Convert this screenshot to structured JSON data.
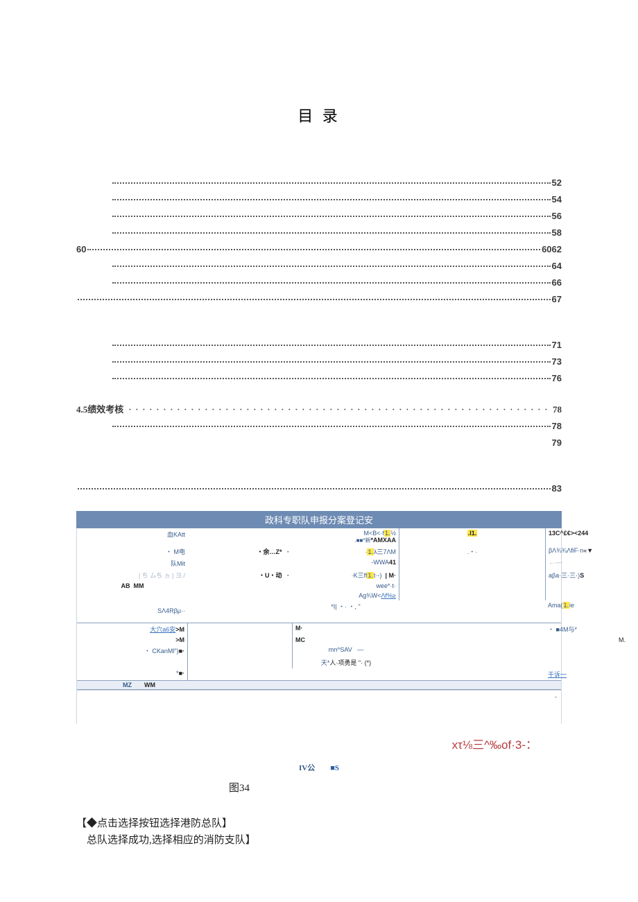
{
  "title": "目 录",
  "toc": {
    "group1": [
      {
        "label": "",
        "page": "52",
        "indent": true
      },
      {
        "label": "",
        "page": "54",
        "indent": true
      },
      {
        "label": "",
        "page": "56",
        "indent": true
      },
      {
        "label": "",
        "page": "58",
        "indent": true
      },
      {
        "label": "60",
        "page": "6062",
        "indent": false
      },
      {
        "label": "",
        "page": "64",
        "indent": true
      },
      {
        "label": "",
        "page": "66",
        "indent": true
      },
      {
        "label": "",
        "page": "67",
        "indent": false
      }
    ],
    "group2": [
      {
        "label": "",
        "page": "71",
        "indent": true
      },
      {
        "label": "",
        "page": "73",
        "indent": true
      },
      {
        "label": "",
        "page": "76",
        "indent": true
      }
    ],
    "heading": {
      "label": "4.5绩效考核",
      "page": "78"
    },
    "group3": [
      {
        "label": "",
        "page": "78",
        "indent": true
      }
    ],
    "right_only": "79",
    "group4": [
      {
        "label": "",
        "page": "83",
        "indent": false
      }
    ]
  },
  "figure": {
    "titlebar": "政科专职队申报分案登记安",
    "row1": {
      "c1": "血KAtt",
      "c3a": "M<B<·f",
      "c3a_hl": "1.",
      "c3a2": "½",
      "c3b_pre": ".■■*新",
      "c3b": "*AMXAA",
      "c4": ".I1.",
      "c5": "13C^£€><244"
    },
    "row2": {
      "c1": "・ M电",
      "c1b": "・余…Z*",
      "c2": "·",
      "c3_pre": "·",
      "c3_hl": "1.",
      "c3": "λ三7ΛM",
      "c4": ".・·",
      "c5": "βΛ¾¾ΛfiF·n",
      "c5b": "«▼"
    },
    "row3": {
      "c1": "队Mit",
      "c3": "-WWA",
      "c3b": "41",
      "c5": "←—·"
    },
    "row4": {
      "c1a": "| ち ムち ヵ | ヨ./",
      "c1b": "・U・动",
      "c2": "·",
      "c3a": "·K三ff",
      "c3a_hl": "1.",
      "c3a2": "t·-)",
      "c3b": "| M·",
      "c5": "aβa·三·三·)",
      "c5b": "S"
    },
    "row5": {
      "c1a": "AB",
      "c1b": "MM",
      "c3": "wee*·",
      "c3b": "t·"
    },
    "row6": {
      "c3": "Ag¾W<",
      "c3b": "Λf%≥"
    },
    "row7": {
      "c1": "SΛ4Rβμ··",
      "c3": "*I| ・· ・,  \"",
      "c5a": "Ama(",
      "c5_hl": "1.",
      "c5b": "ie"
    },
    "sec2": {
      "r1": {
        "c1": "大穴a6安",
        "c1b": ">M",
        "c3": "M·",
        "c5a": "・ ■4M与*"
      },
      "r2": {
        "c1b": ">M",
        "c3": "MC",
        "c5b": "M."
      },
      "r3": {
        "c1a": "・ CKanMl\")",
        "c1b": "■·",
        "c3": "mn^SAV",
        "c3b": "—"
      },
      "r4": {
        "c3": "天*",
        "c3b": "人·项勇是 \"·  (*)"
      },
      "r5": {
        "c1": "*",
        "c1b": "■·",
        "c5": "干诉一"
      }
    },
    "barrow": {
      "a": "MZ",
      "b": "WM"
    },
    "footnote": "xτ⅛三^‰of·3-：",
    "footer": {
      "a": "IV公",
      "b": "■S"
    },
    "caption": "图34"
  },
  "instructions": {
    "line1": "【◆点击选择按钮选择港防总队】",
    "line2": "　总队选择成功,选择相应的消防支队】"
  }
}
